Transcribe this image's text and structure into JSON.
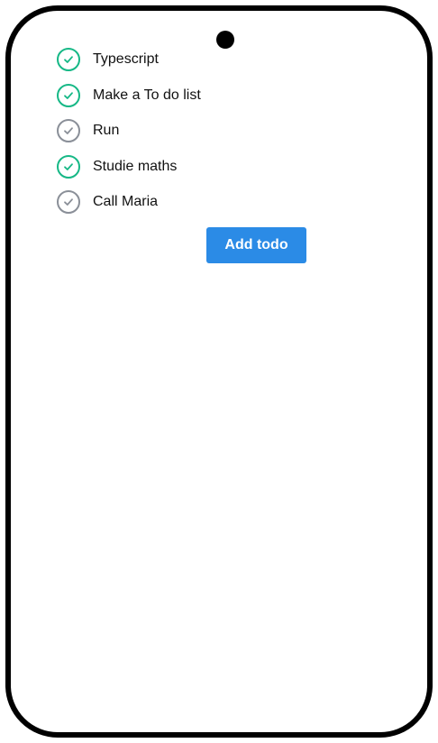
{
  "todos": [
    {
      "label": "Typescript",
      "completed": true,
      "icon": "check-icon"
    },
    {
      "label": "Make a To do list",
      "completed": true,
      "icon": "check-icon"
    },
    {
      "label": "Run",
      "completed": false,
      "icon": "check-icon"
    },
    {
      "label": "Studie maths",
      "completed": true,
      "icon": "check-icon"
    },
    {
      "label": "Call Maria",
      "completed": false,
      "icon": "check-icon"
    }
  ],
  "add_button_label": "Add todo",
  "colors": {
    "completed": "#16b886",
    "pending": "#8a8f98",
    "accent": "#2b8be6",
    "frame": "#000000"
  }
}
